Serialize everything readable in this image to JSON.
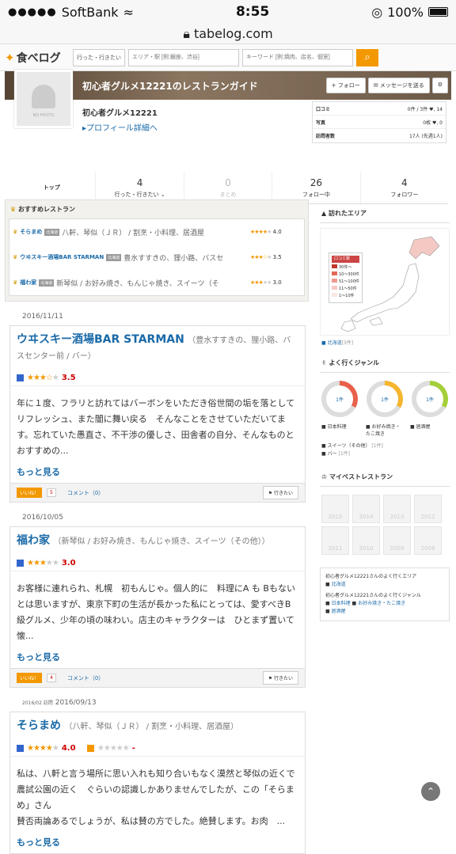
{
  "statusbar": {
    "carrier": "SoftBank",
    "time": "8:55",
    "battery": "100%"
  },
  "url": "tabelog.com",
  "header": {
    "logo": "食べログ",
    "search_label": "行った・行きたい",
    "area_placeholder": "エリア・駅 [例:銀座、渋谷]",
    "keyword_placeholder": "キーワード [例:焼肉、店名、個室]"
  },
  "profile": {
    "title": "初心者グルメ12221のレストランガイド",
    "follow": "フォロー",
    "message": "メッセージを送る",
    "no_photo": "NO PHOTO",
    "name": "初心者グルメ12221",
    "detail_link": "プロフィール詳細へ",
    "stats": [
      {
        "label": "口コミ",
        "value": "0件 / 3件  ♥, 14"
      },
      {
        "label": "写真",
        "value": "0枚  ♥, 0"
      },
      {
        "label": "訪問者数",
        "value": "17人 (先週1人)"
      }
    ]
  },
  "tabs": [
    {
      "n": "",
      "label": "トップ"
    },
    {
      "n": "4",
      "label": "行った・行きたい"
    },
    {
      "n": "0",
      "label": "まとめ"
    },
    {
      "n": "26",
      "label": "フォロー中"
    },
    {
      "n": "4",
      "label": "フォロワー"
    }
  ],
  "recommend": {
    "title": "おすすめレストラン",
    "items": [
      {
        "name": "そらまめ",
        "tag": "北海道",
        "area": "八軒、琴似（ＪＲ） / 割烹・小料理、居酒屋",
        "score": "4.0"
      },
      {
        "name": "ウヰスキー酒場BAR STARMAN",
        "tag": "北海道",
        "area": "豊水すすきの、狸小路、バスセ",
        "score": "3.5"
      },
      {
        "name": "福わ家",
        "tag": "北海道",
        "area": "新琴似 / お好み焼き、もんじゃ焼き、スイーツ（そ",
        "score": "3.0"
      }
    ]
  },
  "reviews": [
    {
      "date": "2016/11/11",
      "name": "ウヰスキー酒場BAR STARMAN",
      "area": "（豊水すすきの、狸小路、バスセンター前 / バー）",
      "score": "3.5",
      "body": "年に１度、フラリと訪れてはバーボンをいただき俗世間の垢を落としてリフレッシュ、また闇に舞い戻る　そんなことをさせていただいてます。忘れていた愚直さ、不干渉の優しさ、田舎者の自分、そんなものとおすすめの...",
      "more": "もっと見る",
      "likes": "5",
      "comments": "コメント（0）"
    },
    {
      "date": "2016/10/05",
      "name": "福わ家",
      "area": "（新琴似 / お好み焼き、もんじゃ焼き、スイーツ（その他））",
      "score": "3.0",
      "body": "お客様に連れられ、札幌　初もんじゃ。個人的に　料理にA も Bもないとは思いますが、東京下町の生活が長かった私にとっては、愛すべきB 級グルメ、少年の頃の味わい。店主のキャラクターは　ひとまず置いて　懐...",
      "more": "もっと見る",
      "likes": "4",
      "comments": "コメント（0）"
    },
    {
      "date_prefix": "2016/02 訪問",
      "date": "2016/09/13",
      "name": "そらまめ",
      "area": "（八軒、琴似（ＪＲ） / 割烹・小料理、居酒屋）",
      "score": "4.0",
      "score2": "-",
      "body": "私は、八軒と言う場所に思い入れも知り合いもなく漠然と琴似の近くで農試公園の近く　ぐらいの認識しかありませんでしたが、この「そらまめ」さん\n賛否両論あるでしょうが、私は賛の方でした。絶賛します。お肉　...",
      "more": "もっと見る"
    }
  ],
  "go_label": "行きたい",
  "like_label": "いいね！",
  "side": {
    "visited_title": "訪れたエリア",
    "legend_title": "口コミ数",
    "legend": [
      "30件〜",
      "10〜300件",
      "51〜100件",
      "11〜50件",
      "1〜10件"
    ],
    "area": "北海道",
    "area_count": "[3件]",
    "genre_title": "よく行くジャンル",
    "donuts": [
      {
        "label": "1件",
        "color": "#e8604c"
      },
      {
        "label": "1件",
        "color": "#f5b52e"
      },
      {
        "label": "1件",
        "color": "#a4cf3a"
      }
    ],
    "genres": [
      "日本料理",
      "お好み焼き・たこ焼き",
      "居酒屋"
    ],
    "genre_extra": [
      {
        "name": "スイーツ（その他）",
        "count": "[1件]"
      },
      {
        "name": "バー",
        "count": "[1件]"
      }
    ],
    "best_title": "マイベストレストラン",
    "years": [
      "2015",
      "2014",
      "2013",
      "2012",
      "2011",
      "2010",
      "2009",
      "2008"
    ],
    "freq_area_title": "初心者グルメ12221さんのよく行くエリア",
    "freq_area": "北海道",
    "freq_genre_title": "初心者グルメ12221さんのよく行くジャンル",
    "freq_genre_1": "日本料理",
    "freq_genre_2": "お好み焼き・たこ焼き",
    "freq_genre_3": "居酒屋"
  }
}
